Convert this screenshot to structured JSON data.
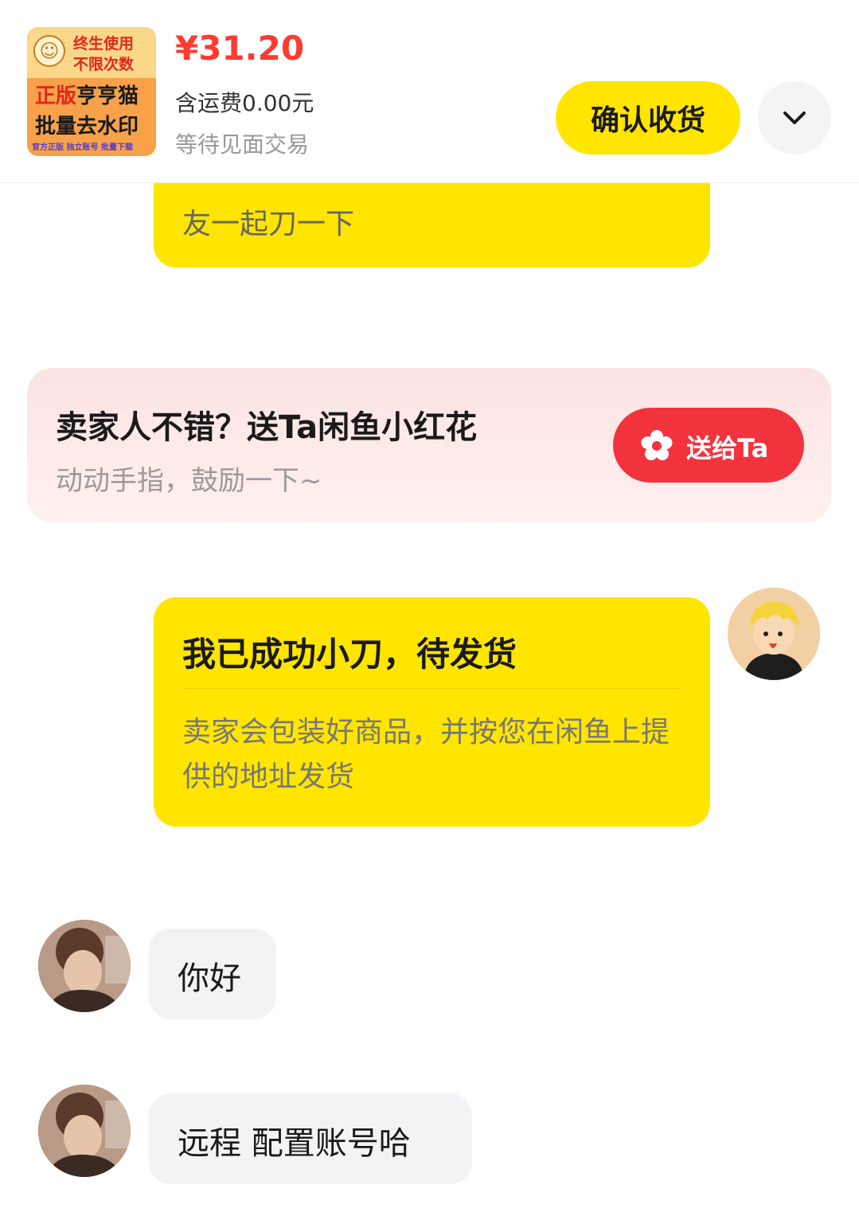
{
  "order": {
    "thumbnail": {
      "line1": "终生使用",
      "line2": "不限次数",
      "line3_red": "正版",
      "line3_rest": "亨亨猫",
      "line4": "批量去水印",
      "line5": "官方正版 独立账号 批量下载"
    },
    "price": "¥31.20",
    "shipping": "含运费0.00元",
    "status": "等待见面交易",
    "confirm_label": "确认收货",
    "expand_icon": "chevron-down-icon"
  },
  "chat": {
    "partial_message": "友一起刀一下",
    "flower_card": {
      "title": "卖家人不错？送Ta闲鱼小红花",
      "subtitle": "动动手指，鼓励一下~",
      "button_label": "送给Ta",
      "button_icon": "flower-icon",
      "button_color": "#f2333d"
    },
    "status_card": {
      "title": "我已成功小刀，待发货",
      "description": "卖家会包装好商品，并按您在闲鱼上提供的地址发货"
    },
    "messages": [
      {
        "sender": "seller",
        "text": "你好"
      },
      {
        "sender": "seller",
        "text": "远程 配置账号哈"
      }
    ]
  },
  "colors": {
    "brand_yellow": "#ffe500",
    "price_red": "#ff3b30"
  }
}
